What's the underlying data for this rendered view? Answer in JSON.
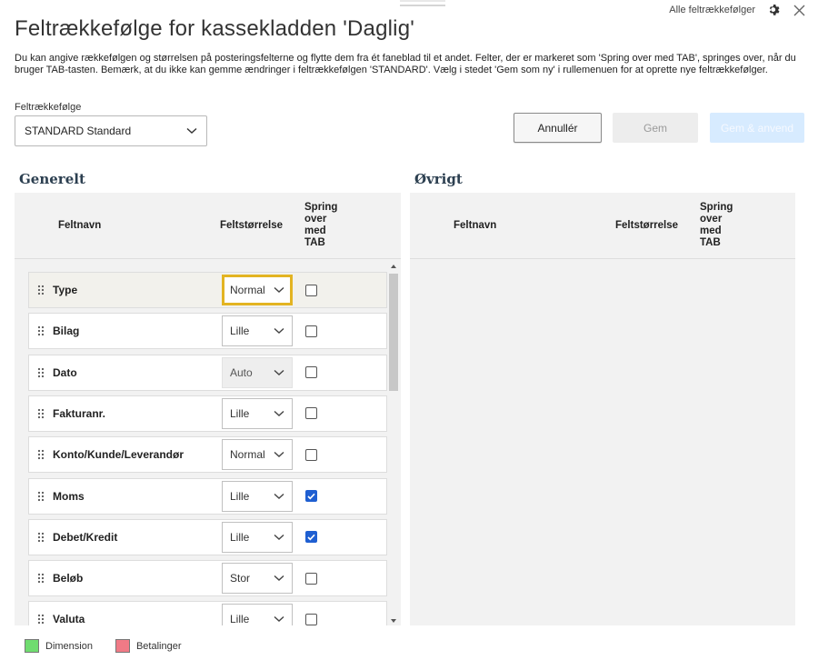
{
  "window": {
    "all_orders_link": "Alle feltrækkefølger",
    "settings_icon": "gear-icon",
    "close_icon": "close-icon"
  },
  "title": "Feltrækkefølge for kassekladden 'Daglig'",
  "description": "Du kan angive rækkefølgen og størrelsen på posteringsfelterne og flytte dem fra ét faneblad til et andet. Felter, der er markeret som 'Spring over med TAB', springes over, når du bruger TAB-tasten. Bemærk, at du ikke kan gemme ændringer i feltrækkefølgen 'STANDARD'. Vælg i stedet 'Gem som ny' i rullemenuen for at oprette nye feltrækkefølger.",
  "order_select": {
    "label": "Feltrækkefølge",
    "value": "STANDARD Standard"
  },
  "buttons": {
    "cancel": "Annullér",
    "save": "Gem",
    "save_apply": "Gem & anvend"
  },
  "sections": {
    "general": "Generelt",
    "other": "Øvrigt"
  },
  "columns": {
    "name": "Feltnavn",
    "size": "Feltstørrelse",
    "skip": [
      "Spring",
      "over",
      "med",
      "TAB"
    ]
  },
  "general_fields": [
    {
      "name": "Type",
      "size": "Normal",
      "skip_tab": false,
      "disabled": false,
      "focused": true
    },
    {
      "name": "Bilag",
      "size": "Lille",
      "skip_tab": false,
      "disabled": false,
      "focused": false
    },
    {
      "name": "Dato",
      "size": "Auto",
      "skip_tab": false,
      "disabled": true,
      "focused": false
    },
    {
      "name": "Fakturanr.",
      "size": "Lille",
      "skip_tab": false,
      "disabled": false,
      "focused": false
    },
    {
      "name": "Konto/Kunde/Leverandør",
      "size": "Normal",
      "skip_tab": false,
      "disabled": false,
      "focused": false
    },
    {
      "name": "Moms",
      "size": "Lille",
      "skip_tab": true,
      "disabled": false,
      "focused": false
    },
    {
      "name": "Debet/Kredit",
      "size": "Lille",
      "skip_tab": true,
      "disabled": false,
      "focused": false
    },
    {
      "name": "Beløb",
      "size": "Stor",
      "skip_tab": false,
      "disabled": false,
      "focused": false
    },
    {
      "name": "Valuta",
      "size": "Lille",
      "skip_tab": false,
      "disabled": false,
      "focused": false
    }
  ],
  "legend": [
    {
      "label": "Dimension",
      "color": "#6fdc6f"
    },
    {
      "label": "Betalinger",
      "color": "#f07a86"
    }
  ]
}
